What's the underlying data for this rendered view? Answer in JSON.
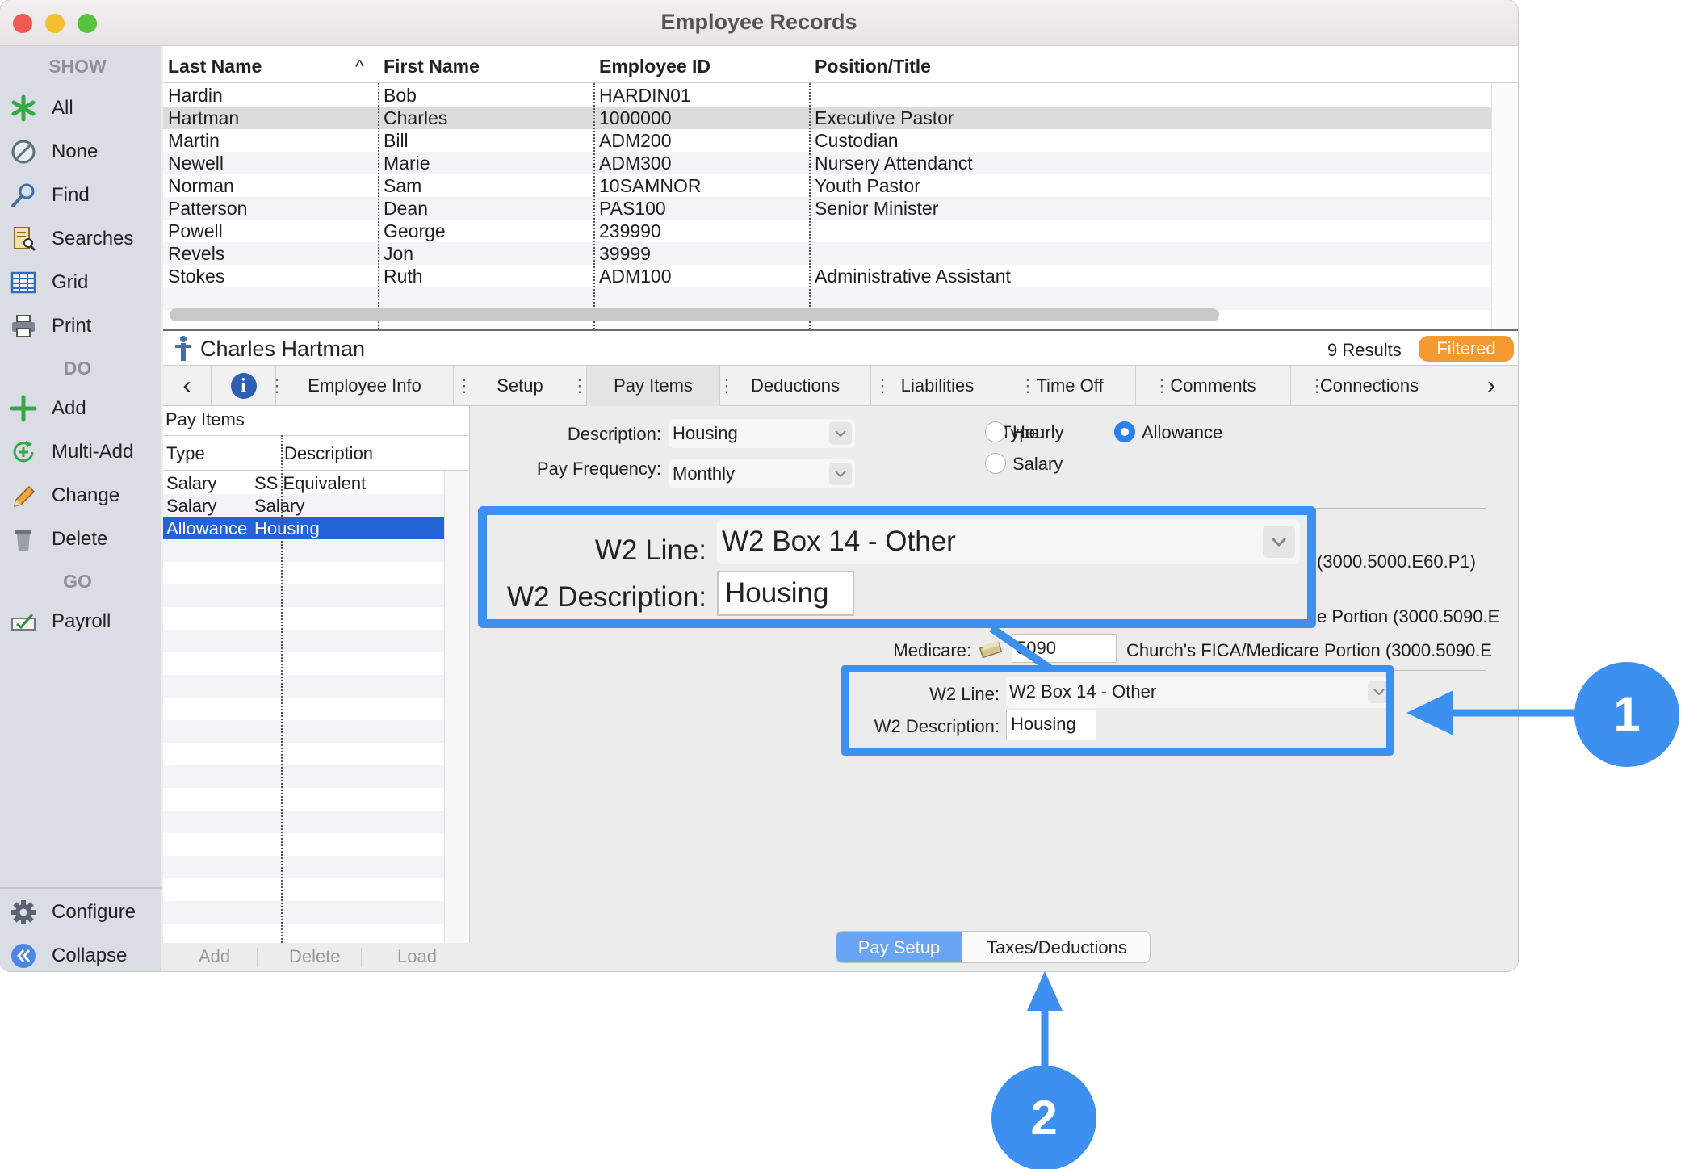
{
  "window": {
    "title": "Employee Records"
  },
  "sidebar": {
    "show_heading": "SHOW",
    "do_heading": "DO",
    "go_heading": "GO",
    "show_items": [
      "All",
      "None",
      "Find",
      "Searches",
      "Grid",
      "Print"
    ],
    "do_items": [
      "Add",
      "Multi-Add",
      "Change",
      "Delete"
    ],
    "go_items": [
      "Payroll"
    ],
    "bottom_items": [
      "Configure",
      "Collapse"
    ]
  },
  "grid": {
    "columns": [
      "Last Name",
      "First Name",
      "Employee ID",
      "Position/Title"
    ],
    "sort_indicator": "^",
    "rows": [
      [
        "Hardin",
        "Bob",
        "HARDIN01",
        ""
      ],
      [
        "Hartman",
        "Charles",
        "1000000",
        "Executive Pastor"
      ],
      [
        "Martin",
        "Bill",
        "ADM200",
        "Custodian"
      ],
      [
        "Newell",
        "Marie",
        "ADM300",
        "Nursery Attendanct"
      ],
      [
        "Norman",
        "Sam",
        "10SAMNOR",
        "Youth Pastor"
      ],
      [
        "Patterson",
        "Dean",
        "PAS100",
        "Senior Minister"
      ],
      [
        "Powell",
        "George",
        "239990",
        ""
      ],
      [
        "Revels",
        "Jon",
        "39999",
        ""
      ],
      [
        "Stokes",
        "Ruth",
        "ADM100",
        "Administrative Assistant"
      ]
    ],
    "selected_row": 1
  },
  "record": {
    "name": "Charles Hartman",
    "results": "9 Results",
    "filter_badge": "Filtered"
  },
  "tabs": {
    "prev": "‹",
    "next": "›",
    "info_icon": "i",
    "items": [
      "Employee Info",
      "Setup",
      "Pay Items",
      "Deductions",
      "Liabilities",
      "Time Off",
      "Comments",
      "Connections"
    ],
    "active": "Pay Items"
  },
  "pay_items": {
    "title": "Pay Items",
    "columns": [
      "Type",
      "Description"
    ],
    "rows": [
      [
        "Salary",
        "SS Equivalent"
      ],
      [
        "Salary",
        "Salary"
      ],
      [
        "Allowance",
        "Housing"
      ]
    ],
    "selected_row": 2,
    "buttons": [
      "Add",
      "Delete",
      "Load"
    ]
  },
  "detail": {
    "description_label": "Description:",
    "description_value": "Housing",
    "frequency_label": "Pay Frequency:",
    "frequency_value": "Monthly",
    "type_label": "Type:",
    "type_options": [
      "Hourly",
      "Allowance",
      "Salary"
    ],
    "type_selected": "Allowance",
    "account_partial_1": "(3000.5000.E60.P1)",
    "account_partial_2": "e Portion (3000.5090.E",
    "medicare_label": "Medicare:",
    "medicare_value": "5090",
    "medicare_account": "Church's FICA/Medicare Portion (3000.5090.E",
    "w2_line_label": "W2 Line:",
    "w2_line_value": "W2 Box 14 - Other",
    "w2_desc_label": "W2 Description:",
    "w2_desc_value": "Housing"
  },
  "segments": {
    "active": "Pay Setup",
    "inactive": "Taxes/Deductions"
  },
  "callouts": {
    "one": "1",
    "two": "2"
  },
  "colors": {
    "accent_blue": "#3d8ff0",
    "selection": "#2462d8",
    "badge": "#f59a30"
  }
}
